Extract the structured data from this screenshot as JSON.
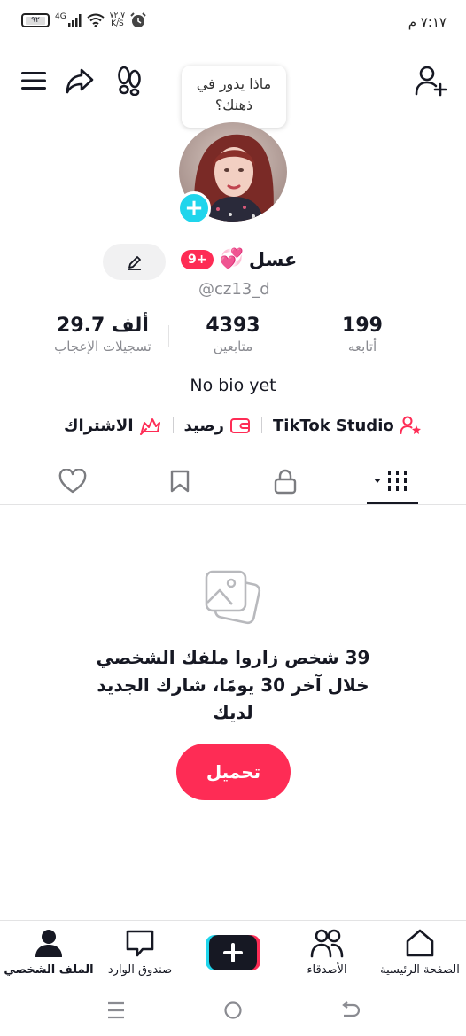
{
  "status_bar": {
    "time": "٧:١٧ م",
    "battery": "٩٢",
    "network": "4G",
    "speed_top": "٧٢٫٧",
    "speed_bottom": "K/S"
  },
  "tooltip": {
    "text": "ماذا يدور في ذهنك؟"
  },
  "profile": {
    "name": "عسل",
    "name_emoji": "💞",
    "notif_badge": "9+",
    "handle": "@cz13_d",
    "bio": "No bio yet"
  },
  "stats": {
    "likes": {
      "value": "29.7",
      "unit": "ألف",
      "label": "تسجيلات الإعجاب"
    },
    "followers": {
      "value": "4393",
      "label": "متابعين"
    },
    "following": {
      "value": "199",
      "label": "أتابعه"
    }
  },
  "links": {
    "studio": "TikTok Studio",
    "balance": "رصيد",
    "subscription": "الاشتراك"
  },
  "empty_state": {
    "message": "39 شخص زاروا ملفك الشخصي خلال آخر 30 يومًا، شارك الجديد لديك",
    "upload_label": "تحميل"
  },
  "bottom_nav": {
    "profile": "الملف الشخصي",
    "inbox": "صندوق الوارد",
    "friends": "الأصدقاء",
    "home": "الصفحة الرئيسية"
  },
  "colors": {
    "accent": "#fe2c55",
    "cyan": "#20d5ec",
    "text": "#161823",
    "muted": "#8a8b91"
  }
}
